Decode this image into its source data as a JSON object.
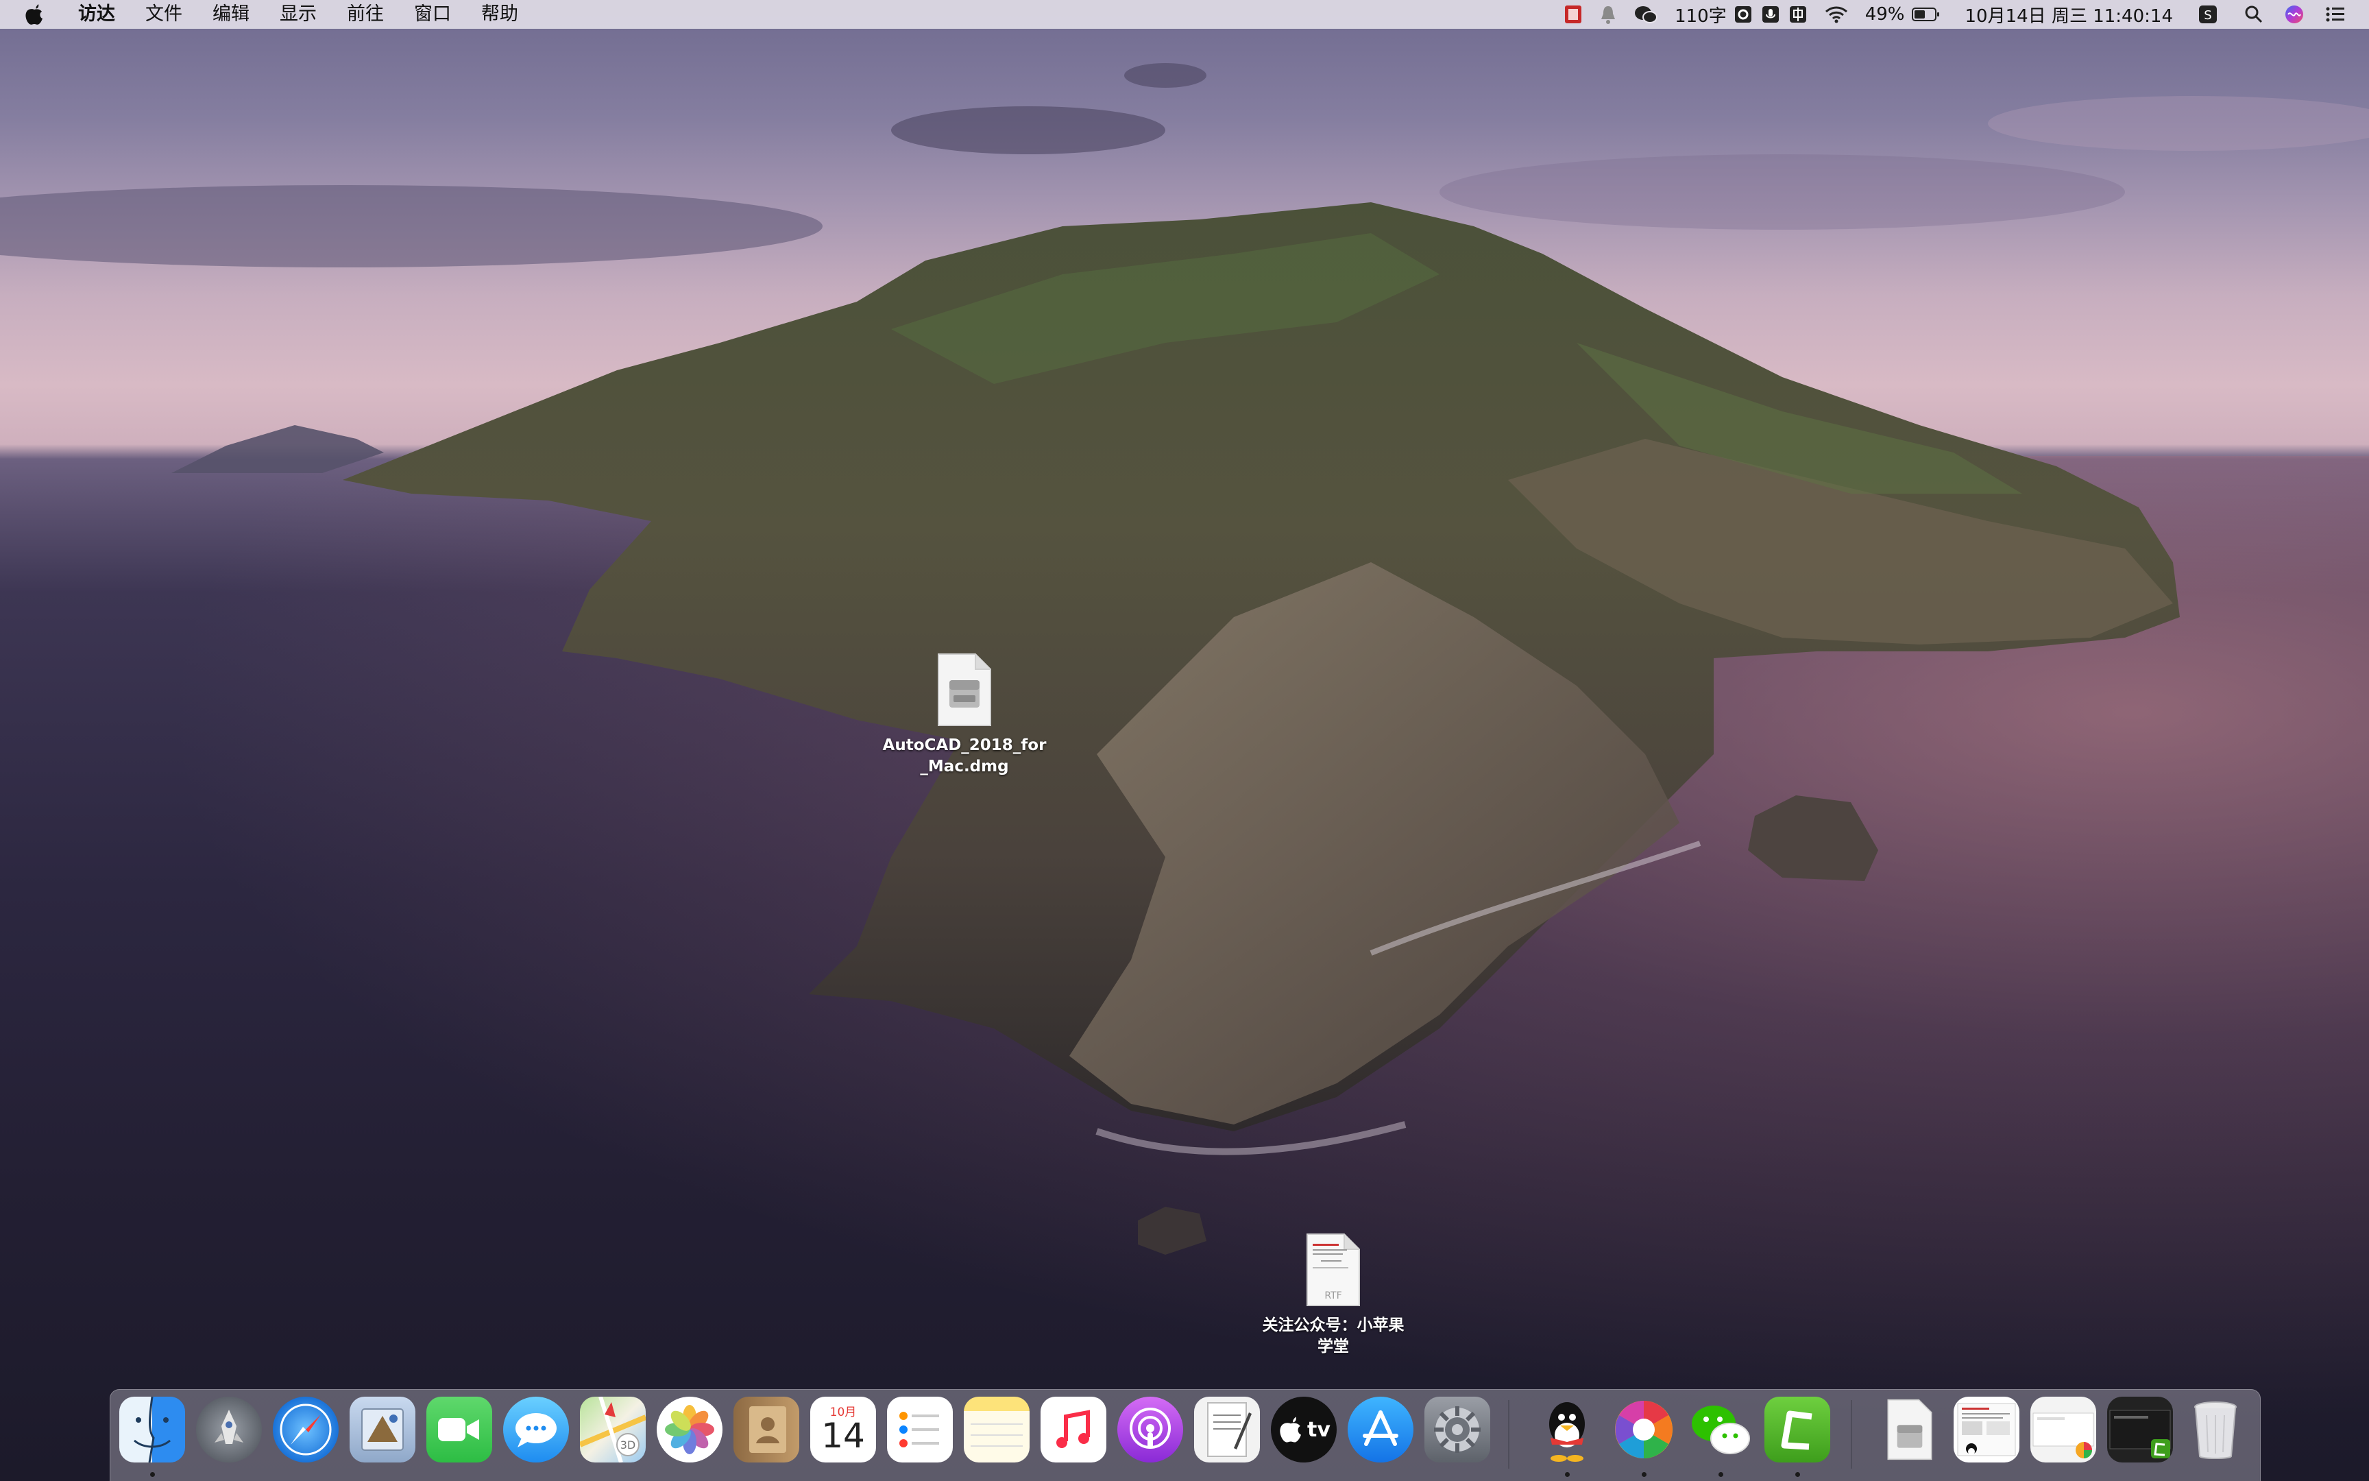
{
  "menubar": {
    "apple_icon": "apple-icon",
    "menus": [
      "访达",
      "文件",
      "编辑",
      "显示",
      "前往",
      "窗口",
      "帮助"
    ],
    "status": {
      "word_count": "110字",
      "battery_percent": "49%",
      "datetime": "10月14日 周三 11:40:14"
    }
  },
  "desktop": {
    "icons": [
      {
        "name": "AutoCAD_2018_for_Mac.dmg",
        "label_line1": "AutoCAD_2018_for",
        "label_line2": "_Mac.dmg",
        "icon": "dmg-file-icon"
      },
      {
        "name": "关注公众号：小苹果学堂",
        "label_line1": "关注公众号：小苹果",
        "label_line2": "学堂",
        "icon": "rtf-file-icon",
        "badge": "RTF"
      }
    ]
  },
  "dock": {
    "items": [
      {
        "name": "Finder",
        "icon": "finder-icon",
        "running": true
      },
      {
        "name": "Launchpad",
        "icon": "launchpad-icon",
        "running": false
      },
      {
        "name": "Safari",
        "icon": "safari-icon",
        "running": false
      },
      {
        "name": "Mail",
        "icon": "mail-icon",
        "running": false
      },
      {
        "name": "FaceTime",
        "icon": "facetime-icon",
        "running": false
      },
      {
        "name": "Messages",
        "icon": "messages-icon",
        "running": false
      },
      {
        "name": "Maps",
        "icon": "maps-icon",
        "running": false
      },
      {
        "name": "Photos",
        "icon": "photos-icon",
        "running": false
      },
      {
        "name": "Contacts",
        "icon": "contacts-icon",
        "running": false
      },
      {
        "name": "Calendar",
        "icon": "calendar-icon",
        "running": false,
        "month": "10月",
        "day": "14"
      },
      {
        "name": "Reminders",
        "icon": "reminders-icon",
        "running": false
      },
      {
        "name": "Notes",
        "icon": "notes-icon",
        "running": false
      },
      {
        "name": "Music",
        "icon": "music-icon",
        "running": false
      },
      {
        "name": "Podcasts",
        "icon": "podcasts-icon",
        "running": false
      },
      {
        "name": "TextEdit",
        "icon": "textedit-icon",
        "running": false
      },
      {
        "name": "TV",
        "icon": "tv-icon",
        "running": false,
        "label": "tv"
      },
      {
        "name": "App Store",
        "icon": "app-store-icon",
        "running": false
      },
      {
        "name": "System Preferences",
        "icon": "system-preferences-icon",
        "running": false
      },
      {
        "name": "QQ",
        "icon": "qq-icon",
        "running": true
      },
      {
        "name": "Browser",
        "icon": "pinwheel-browser-icon",
        "running": true
      },
      {
        "name": "WeChat",
        "icon": "wechat-icon",
        "running": true
      },
      {
        "name": "Camtasia",
        "icon": "camtasia-icon",
        "running": true
      },
      {
        "name": "Disk image",
        "icon": "dmg-file-icon",
        "running": false
      },
      {
        "name": "Document preview",
        "icon": "document-preview-icon",
        "running": false
      },
      {
        "name": "Screenshot",
        "icon": "screenshot-icon",
        "running": false
      },
      {
        "name": "Recording",
        "icon": "recording-icon",
        "running": false
      },
      {
        "name": "Trash",
        "icon": "trash-icon",
        "running": false
      }
    ]
  },
  "colors": {
    "menubar_bg": "#e8e4ec",
    "dock_bg": "#c8c4d2",
    "sky_top": "#6f6a8f",
    "sky_glow": "#d8bac5",
    "sea": "#2c2740"
  }
}
